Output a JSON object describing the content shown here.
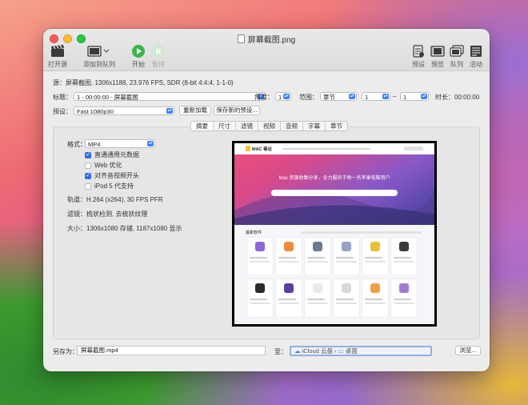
{
  "window": {
    "title": "屏幕截图.png"
  },
  "toolbar": {
    "open_source": "打开源",
    "add_to_queue": "添加到队列",
    "start": "开始",
    "pause": "暂停",
    "presets": "预设",
    "preview": "预览",
    "queue": "队列",
    "activity": "活动"
  },
  "source": {
    "label": "源：",
    "value": "屏幕截图, 1306x1188, 23.976 FPS, SDR (8-bit 4:4:4, 1-1-0)"
  },
  "title_row": {
    "label": "标题：",
    "value": "1 - 00:00:00 - 屏幕截图",
    "angle_label": "角度：",
    "angle_value": "1",
    "range_label": "范围：",
    "range_type": "章节",
    "range_start": "1",
    "range_sep": "–",
    "range_end": "1",
    "duration_label": "时长：",
    "duration_value": "00:00:00"
  },
  "preset_row": {
    "label": "预设：",
    "value": "Fast 1080p30",
    "reload_button": "重新加载",
    "save_new_button": "保存新的预设..."
  },
  "tabs": [
    "摘要",
    "尺寸",
    "滤镜",
    "视频",
    "音频",
    "字幕",
    "章节"
  ],
  "summary": {
    "format_label": "格式：",
    "format_value": "MP4",
    "options": [
      {
        "label": "直通通用元数据",
        "checked": true
      },
      {
        "label": "Web 优化",
        "checked": false
      },
      {
        "label": "对齐音视频开头",
        "checked": true
      },
      {
        "label": "iPod 5 代支持",
        "checked": false
      }
    ],
    "track_label": "轨道：",
    "track_value": "H.264 (x264), 30 FPS PFR",
    "filter_label": "滤镜：",
    "filter_value": "梳状检测, 去梳状纹理",
    "size_label": "大小：",
    "size_value": "1306x1080 存储, 1187x1080 显示"
  },
  "preview_image": {
    "site_logo": "MAC 毒论",
    "hero_title": "Mac 资源收集分享，全力服务于每一名苹果电脑用户",
    "section_title": "最新软件"
  },
  "save": {
    "save_as_label": "另存为：",
    "filename": "屏幕截图.mp4",
    "to_label": "至：",
    "location_root": "iCloud 云盘",
    "location_sep": "›",
    "location_folder": "桌面",
    "browse_button": "浏览..."
  },
  "colors": {
    "accent": "#2f6ee8",
    "play_green": "#3bb54a"
  }
}
